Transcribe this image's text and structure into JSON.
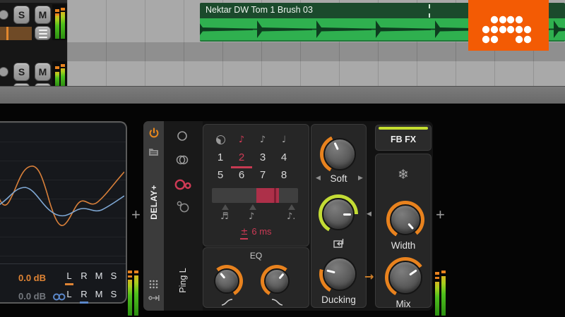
{
  "colors": {
    "accent_orange": "#e8821e",
    "accent_red": "#cf3a55",
    "accent_green": "#c3dc35",
    "accent_blue": "#5b87c9",
    "clip_green": "#2fb04f",
    "logo_orange": "#f35b04"
  },
  "timeline": {
    "clip_name": "Nektar DW Tom 1 Brush 03",
    "tracks": [
      {
        "solo": "S",
        "mute": "M"
      },
      {
        "solo": "S",
        "mute": "M"
      }
    ]
  },
  "scope": {
    "rows": [
      {
        "gain": "0.0 dB",
        "l": "L",
        "r": "R",
        "m": "M",
        "s": "S",
        "active": "L"
      },
      {
        "gain": "0.0 dB",
        "l": "L",
        "r": "R",
        "m": "M",
        "s": "S",
        "active": "R"
      }
    ]
  },
  "device": {
    "title": "DELAY+",
    "mode_label": "Ping L",
    "time_icons": [
      "♪",
      "♪",
      "♩"
    ],
    "steps": [
      "1",
      "2",
      "3",
      "4",
      "5",
      "6",
      "7",
      "8"
    ],
    "selected_step": "2",
    "slider_notes": [
      "♬",
      "♪",
      "♪."
    ],
    "offset_sign": "±",
    "offset_value": "6 ms",
    "eq": {
      "label": "EQ"
    },
    "fbfx": {
      "label": "FB FX",
      "freeze_icon": "❄"
    },
    "nav": {
      "prev": "◀",
      "next": "▶",
      "mod_arrow": "◀",
      "route_arrow": "→"
    },
    "knobs": {
      "soft": {
        "label": "Soft",
        "color": "#e8821e",
        "angle": -25,
        "arc": [
          -150,
          -25
        ]
      },
      "feedback": {
        "color": "#c3dc35",
        "angle": 90,
        "arc": [
          -150,
          90
        ]
      },
      "ducking": {
        "label": "Ducking",
        "color": "#e8821e",
        "angle": -76,
        "arc": [
          -150,
          -76
        ]
      },
      "eq_hp": {
        "color": "#e8821e",
        "angle": -40,
        "arc": [
          -40,
          150
        ]
      },
      "eq_lp": {
        "color": "#e8821e",
        "angle": 40,
        "arc": [
          -150,
          40
        ]
      },
      "width": {
        "label": "Width",
        "color": "#e8821e",
        "angle": 138,
        "arc": [
          -150,
          142
        ]
      },
      "mix": {
        "label": "Mix",
        "color": "#e8821e",
        "angle": 55,
        "arc": [
          -150,
          55
        ]
      }
    }
  }
}
